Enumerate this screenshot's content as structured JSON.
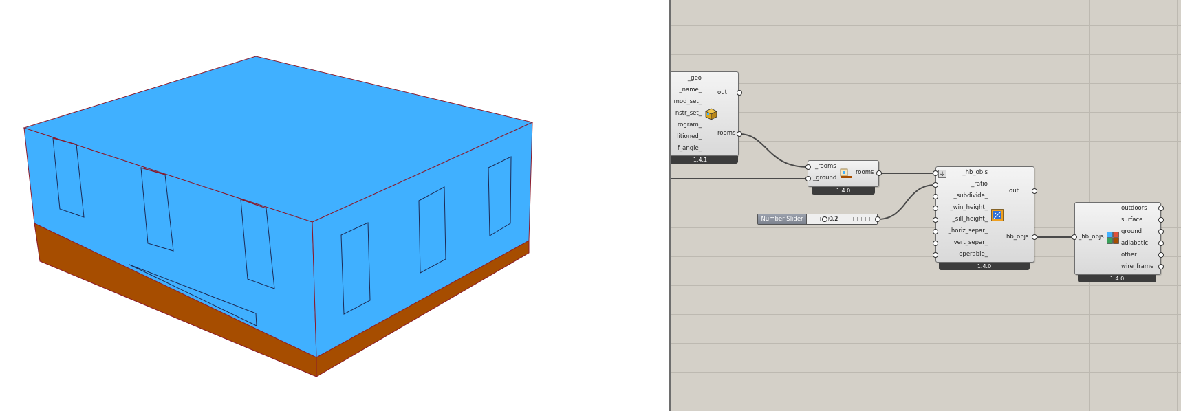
{
  "colors": {
    "wall": "#40b0ff",
    "ground_slab": "#a64d00",
    "edge": "#8b1a2b",
    "canvas_bg": "#d4d0c8",
    "component": "#e4e4e4",
    "version_bar": "#3c3c3c"
  },
  "viewport": {
    "label": "3D model viewport"
  },
  "grasshopper": {
    "room_component": {
      "inputs": [
        "_geo",
        "_name_",
        "mod_set_",
        "nstr_set_",
        "rogram_",
        "litioned_",
        "f_angle_"
      ],
      "outputs": [
        "out",
        "rooms"
      ],
      "version": "1.4.1",
      "icon": "room-cube-icon"
    },
    "solve_adjacency": {
      "inputs": [
        "_rooms",
        "_ground"
      ],
      "outputs": [
        "rooms"
      ],
      "version": "1.4.0",
      "icon": "ground-adjacency-icon"
    },
    "slider": {
      "name": "Number Slider",
      "value": "0.2"
    },
    "aperture_by_ratio": {
      "inputs": [
        "_hb_objs",
        "_ratio",
        "_subdivide_",
        "_win_height_",
        "_sill_height_",
        "_horiz_separ_",
        "vert_separ_",
        "operable_"
      ],
      "outputs": [
        "out",
        "hb_objs"
      ],
      "version": "1.4.0",
      "icon": "window-ratio-icon"
    },
    "visualize_bc": {
      "inputs": [
        "_hb_objs"
      ],
      "outputs": [
        "outdoors",
        "surface",
        "ground",
        "adiabatic",
        "other",
        "wire_frame"
      ],
      "version": "1.4.0",
      "icon": "boundary-color-icon"
    }
  }
}
